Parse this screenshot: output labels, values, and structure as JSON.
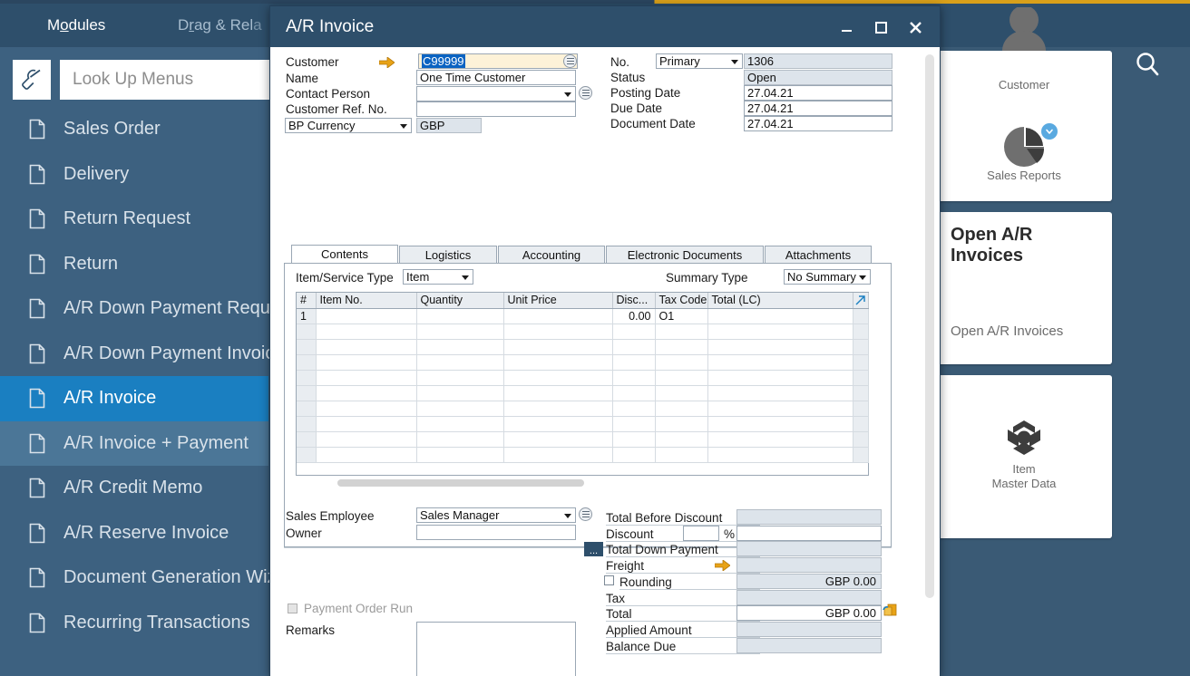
{
  "app": {
    "menubar": [
      {
        "label": "Modules",
        "accel": "o",
        "active": true
      },
      {
        "label": "Drag & Relate",
        "accel": "r",
        "active": false
      }
    ],
    "lookup": {
      "placeholder": "Look Up Menus",
      "value": "",
      "icon": "wrench-icon"
    },
    "sidebar_items": [
      {
        "label": "Sales Order",
        "state": "normal"
      },
      {
        "label": "Delivery",
        "state": "normal"
      },
      {
        "label": "Return Request",
        "state": "normal"
      },
      {
        "label": "Return",
        "state": "normal"
      },
      {
        "label": "A/R Down Payment Request",
        "state": "normal"
      },
      {
        "label": "A/R Down Payment Invoice",
        "state": "normal"
      },
      {
        "label": "A/R Invoice",
        "state": "active"
      },
      {
        "label": "A/R Invoice + Payment",
        "state": "hover"
      },
      {
        "label": "A/R Credit Memo",
        "state": "normal"
      },
      {
        "label": "A/R Reserve Invoice",
        "state": "normal"
      },
      {
        "label": "Document Generation Wizard",
        "state": "normal"
      },
      {
        "label": "Recurring Transactions",
        "state": "normal"
      }
    ],
    "header_icons": [
      {
        "name": "note-icon",
        "glyph": "◧"
      },
      {
        "name": "pencil-icon",
        "glyph": "✎"
      },
      {
        "name": "search-icon",
        "glyph": "⚲"
      }
    ],
    "tiles": [
      {
        "name": "customer-tile",
        "label": "Customer",
        "icon": "person-icon",
        "badge": false
      },
      {
        "name": "sales-reports-tile",
        "label": "Sales Reports",
        "icon": "pie-chart-icon",
        "badge": true
      },
      {
        "name": "open-ar-invoices-tile",
        "title": "Open A/R Invoices",
        "sub": "Open A/R Invoices",
        "icon": "kpi-icon",
        "badge": false
      },
      {
        "name": "item-master-data-tile",
        "label": "Item\nMaster Data",
        "label_line1": "Item",
        "label_line2": "Master Data",
        "icon": "cube-icon",
        "badge": false
      }
    ],
    "colors": {
      "accent_blue": "#1a7fc1",
      "shell_blue": "#3d6180",
      "menu_blue": "#2e4f6b",
      "gold": "#d9a01a",
      "field_focus": "#fdf2d8",
      "field_readonly": "#dde4eb"
    }
  },
  "window": {
    "title": "A/R Invoice",
    "controls": [
      {
        "name": "minimize-button",
        "glyph": "–"
      },
      {
        "name": "maximize-button",
        "glyph": "□"
      },
      {
        "name": "close-button",
        "glyph": "✕"
      }
    ],
    "header_left": [
      {
        "key": "customer",
        "label": "Customer",
        "value": "C99999",
        "selected": true,
        "arrow": true,
        "lookup": true,
        "readonly": false
      },
      {
        "key": "name",
        "label": "Name",
        "value": "One Time Customer",
        "readonly": false
      },
      {
        "key": "contact_person",
        "label": "Contact Person",
        "value": "",
        "dropdown": true,
        "list_icon": true
      },
      {
        "key": "customer_ref_no",
        "label": "Customer Ref. No.",
        "value": "",
        "readonly": false
      }
    ],
    "bp_currency": {
      "label": "BP Currency",
      "value": "GBP"
    },
    "header_right": [
      {
        "key": "no",
        "label": "No.",
        "series": "Primary",
        "value": "1306",
        "readonly": true
      },
      {
        "key": "status",
        "label": "Status",
        "value": "Open",
        "readonly": true
      },
      {
        "key": "posting_date",
        "label": "Posting Date",
        "value": "27.04.21",
        "readonly": false
      },
      {
        "key": "due_date",
        "label": "Due Date",
        "value": "27.04.21",
        "readonly": false
      },
      {
        "key": "document_date",
        "label": "Document Date",
        "value": "27.04.21",
        "readonly": false
      }
    ],
    "tabs": [
      {
        "label": "Contents",
        "active": true
      },
      {
        "label": "Logistics",
        "active": false
      },
      {
        "label": "Accounting",
        "active": false
      },
      {
        "label": "Electronic Documents",
        "active": false
      },
      {
        "label": "Attachments",
        "active": false
      }
    ],
    "contents": {
      "item_service_type": {
        "label": "Item/Service Type",
        "value": "Item"
      },
      "summary_type": {
        "label": "Summary Type",
        "value": "No Summary"
      },
      "grid": {
        "columns": [
          "#",
          "Item No.",
          "Quantity",
          "Unit Price",
          "Disc...",
          "Tax Code",
          "Total (LC)",
          ""
        ],
        "rows": [
          {
            "num": "1",
            "item_no": "",
            "quantity": "",
            "unit_price": "",
            "discount": "0.00",
            "tax_code": "O1",
            "total_lc": ""
          },
          {
            "num": "",
            "item_no": "",
            "quantity": "",
            "unit_price": "",
            "discount": "",
            "tax_code": "",
            "total_lc": ""
          },
          {
            "num": "",
            "item_no": "",
            "quantity": "",
            "unit_price": "",
            "discount": "",
            "tax_code": "",
            "total_lc": ""
          },
          {
            "num": "",
            "item_no": "",
            "quantity": "",
            "unit_price": "",
            "discount": "",
            "tax_code": "",
            "total_lc": ""
          },
          {
            "num": "",
            "item_no": "",
            "quantity": "",
            "unit_price": "",
            "discount": "",
            "tax_code": "",
            "total_lc": ""
          },
          {
            "num": "",
            "item_no": "",
            "quantity": "",
            "unit_price": "",
            "discount": "",
            "tax_code": "",
            "total_lc": ""
          },
          {
            "num": "",
            "item_no": "",
            "quantity": "",
            "unit_price": "",
            "discount": "",
            "tax_code": "",
            "total_lc": ""
          },
          {
            "num": "",
            "item_no": "",
            "quantity": "",
            "unit_price": "",
            "discount": "",
            "tax_code": "",
            "total_lc": ""
          },
          {
            "num": "",
            "item_no": "",
            "quantity": "",
            "unit_price": "",
            "discount": "",
            "tax_code": "",
            "total_lc": ""
          },
          {
            "num": "",
            "item_no": "",
            "quantity": "",
            "unit_price": "",
            "discount": "",
            "tax_code": "",
            "total_lc": ""
          }
        ]
      }
    },
    "footer_left": {
      "sales_employee": {
        "label": "Sales Employee",
        "value": "Sales Manager"
      },
      "owner": {
        "label": "Owner",
        "value": ""
      },
      "payment_order_run": {
        "label": "Payment Order Run",
        "checked": false,
        "disabled": true
      },
      "remarks": {
        "label": "Remarks",
        "value": ""
      }
    },
    "totals": [
      {
        "key": "total_before_discount",
        "label": "Total Before Discount",
        "value": "",
        "readonly": true
      },
      {
        "key": "discount",
        "label": "Discount",
        "pct_value": "",
        "pct_suffix": "%",
        "value": "",
        "readonly": false
      },
      {
        "key": "total_down_payment",
        "label": "Total Down Payment",
        "value": "",
        "readonly": true,
        "dots_button": "..."
      },
      {
        "key": "freight",
        "label": "Freight",
        "value": "",
        "readonly": true,
        "arrow": true
      },
      {
        "key": "rounding",
        "label": "Rounding",
        "value": "GBP 0.00",
        "readonly": true,
        "checkbox": true
      },
      {
        "key": "tax",
        "label": "Tax",
        "value": "",
        "readonly": true
      },
      {
        "key": "total",
        "label": "Total",
        "value": "GBP 0.00",
        "readonly": false,
        "money_icon": true
      },
      {
        "key": "applied_amount",
        "label": "Applied Amount",
        "value": "",
        "readonly": true
      },
      {
        "key": "balance_due",
        "label": "Balance Due",
        "value": "",
        "readonly": true
      }
    ]
  }
}
